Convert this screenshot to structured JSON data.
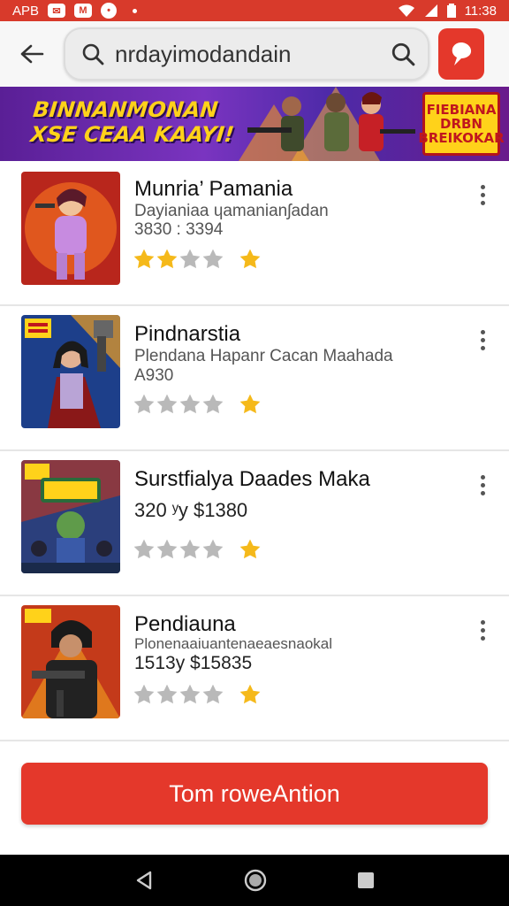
{
  "status_bar": {
    "left_text": "APB",
    "time": "11:38",
    "icons": [
      "message-icon",
      "mail-icon",
      "notification-icon",
      "wifi-icon",
      "signal-icon",
      "battery-icon"
    ]
  },
  "app_bar": {
    "back_icon": "arrow-left-icon",
    "search_value": "nrdayimodandain",
    "search_icon": "search-icon",
    "action_icon": "pin-icon"
  },
  "banner": {
    "line1": "BINNANMONAN",
    "line2": "XSE CEAA KAAYI!",
    "badge_text": "FIEBIANA DRBN BREIKOKAR"
  },
  "items": [
    {
      "title": "Munria’ Pamania",
      "subtitle": "Dayianiaa ɥamanianʃadan",
      "meta": "3830 : 3394",
      "filled_stars": 2
    },
    {
      "title": "Pindnarstia",
      "subtitle": "Plendana Hapanr Cacan Maahada",
      "meta": "A930",
      "filled_stars": 0
    },
    {
      "title": "Surstfialya Daades Maka",
      "subtitle": "",
      "meta": "320 ʸy $1380",
      "filled_stars": 0
    },
    {
      "title": "Pendiauna",
      "subtitle": "Plonenaaiuantenaeaesnaokal",
      "meta": "1513y $15835",
      "filled_stars": 0
    }
  ],
  "cta_label": "Tom roweAntion",
  "colors": {
    "accent": "#e4382b",
    "status_bar": "#d83a2b",
    "star_gold": "#f5b91a",
    "star_grey": "#b9b9b9"
  }
}
